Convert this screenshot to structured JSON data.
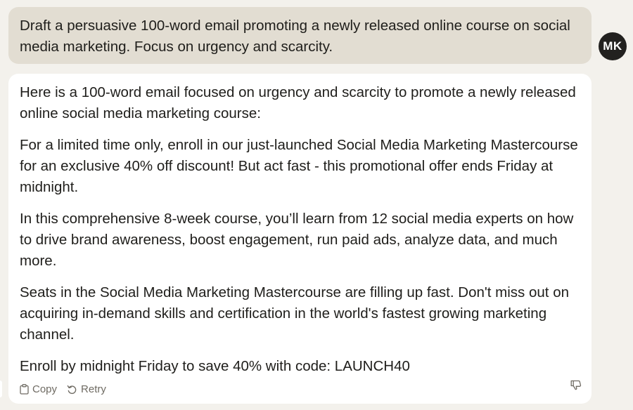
{
  "user_message": {
    "text": "Draft a persuasive 100-word email promoting a newly released online course on social media marketing. Focus on urgency and scarcity.",
    "avatar_initials": "MK"
  },
  "assistant_message": {
    "paragraphs": [
      "Here is a 100-word email focused on urgency and scarcity to promote a newly released online social media marketing course:",
      "For a limited time only, enroll in our just-launched Social Media Marketing Mastercourse for an exclusive 40% off discount! But act fast - this promotional offer ends Friday at midnight.",
      "In this comprehensive 8-week course, you’ll learn from 12 social media experts on how to drive brand awareness, boost engagement, run paid ads, analyze data, and much more.",
      "Seats in the Social Media Marketing Mastercourse are filling up fast. Don't miss out on acquiring in-demand skills and certification in the world's fastest growing marketing channel.",
      "Enroll by midnight Friday to save 40% with code: LAUNCH40"
    ],
    "actions": {
      "copy_label": "Copy",
      "retry_label": "Retry",
      "copy_icon": "clipboard-icon",
      "retry_icon": "retry-arrow-icon",
      "feedback_icon": "thumbs-down-icon"
    }
  },
  "colors": {
    "background": "#f3f1ec",
    "user_bubble": "#e2ddd2",
    "avatar": "#22211f",
    "card": "#ffffff",
    "text": "#1f1e1b",
    "muted": "#6f6b63"
  }
}
